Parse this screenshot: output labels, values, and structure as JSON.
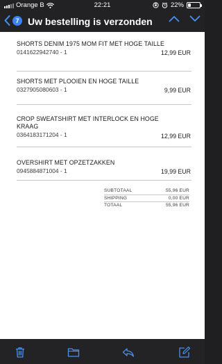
{
  "status": {
    "carrier": "Orange B",
    "time": "22:21",
    "battery_percent": "22%",
    "battery_level": 0.22
  },
  "nav": {
    "back_count": "7",
    "title": "Uw bestelling is verzonden"
  },
  "items": [
    {
      "name": "SHORTS DENIM 1975 MOM FIT MET HOGE TAILLE",
      "code": "0141622942740 - 1",
      "price": "12,99 EUR"
    },
    {
      "name": "SHORTS MET PLOOIEN EN HOGE TAILLE",
      "code": "0327905080603 - 1",
      "price": "9,99 EUR"
    },
    {
      "name_line1": "CROP SWEATSHIRT MET INTERLOCK EN HOGE",
      "name_line2": "KRAAG",
      "code": "0364183171204 - 1",
      "price": "12,99 EUR"
    },
    {
      "name": "OVERSHIRT MET OPZETZAKKEN",
      "code": "0945884871004 - 1",
      "price": "19,99 EUR"
    }
  ],
  "totals": {
    "subtotal_label": "SUBTOTAAL",
    "subtotal_value": "55,96 EUR",
    "shipping_label": "SHIPPING",
    "shipping_value": "0,00 EUR",
    "total_label": "TOTAAL",
    "total_value": "55,96 EUR"
  },
  "toolbar": {
    "icons": [
      "trash-icon",
      "folder-icon",
      "reply-icon",
      "compose-icon"
    ]
  },
  "colors": {
    "accent": "#3b82f6",
    "bar_background": "#222224",
    "content_background": "#ffffff"
  }
}
